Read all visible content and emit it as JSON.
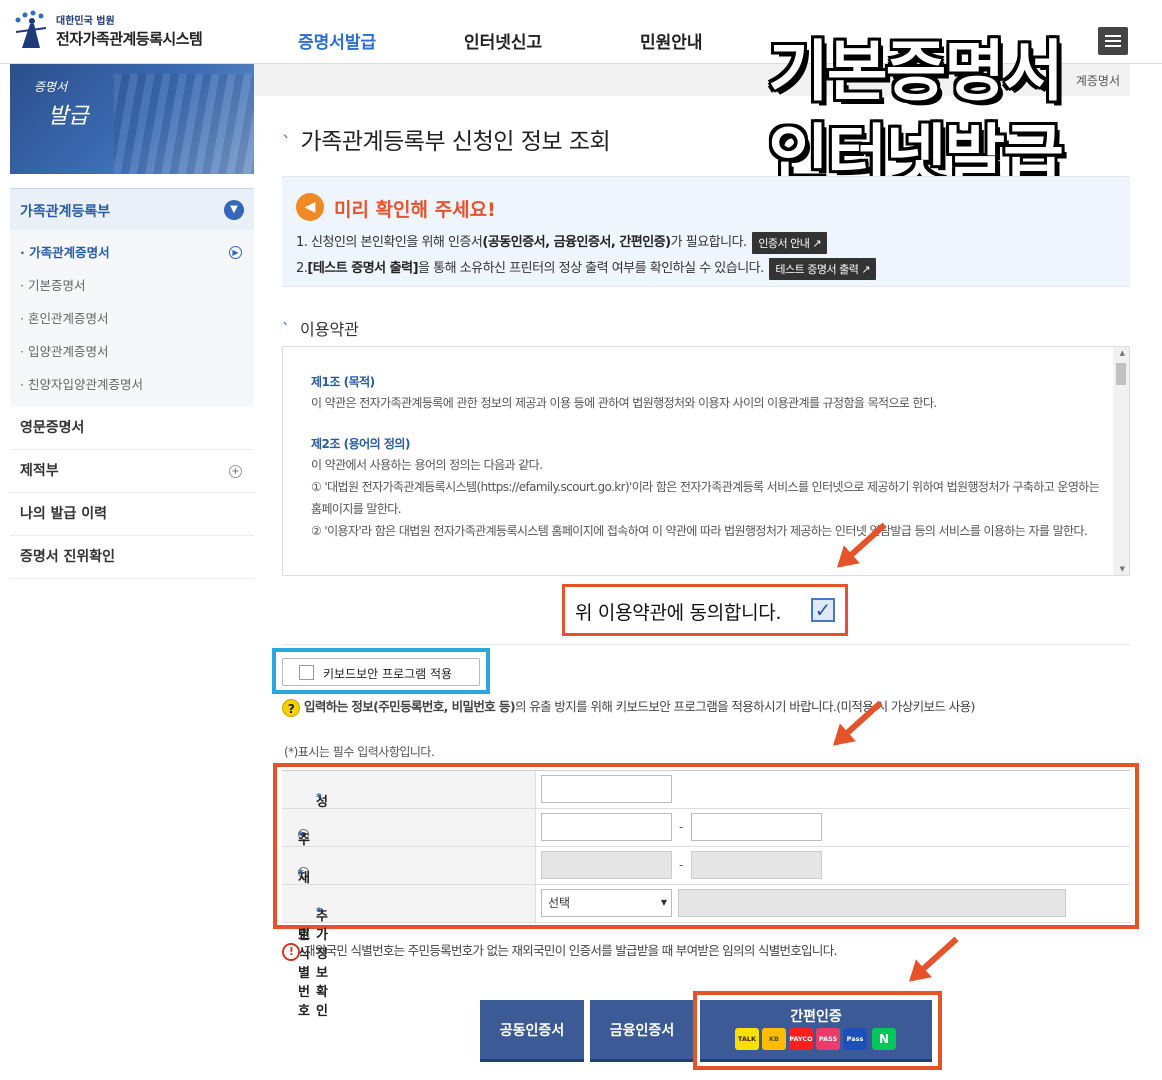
{
  "header": {
    "logo_small": "대한민국 법원",
    "logo_title": "전자가족관계등록시스템",
    "nav": [
      "증명서발급",
      "인터넷신고",
      "민원안내"
    ]
  },
  "overlay": {
    "line1": "기본증명서",
    "line2": "인터넷발급"
  },
  "breadcrumb": "계증명서",
  "sidebar": {
    "banner_line1": "증명서",
    "banner_line2": "발급",
    "group_title": "가족관계등록부",
    "sub_items": [
      "· 가족관계증명서",
      "· 기본증명서",
      "· 혼인관계증명서",
      "· 입양관계증명서",
      "· 친양자입양관계증명서"
    ],
    "main_items": [
      "영문증명서",
      "제적부",
      "나의 발급 이력",
      "증명서 진위확인"
    ]
  },
  "page_title": "가족관계등록부 신청인 정보 조회",
  "notice": {
    "heading": "미리 확인해 주세요!",
    "line1_a": "1. 신청인의 본인확인을 위해 인증서",
    "line1_b": "(공동인증서, 금융인증서, 간편인증)",
    "line1_c": "가 필요합니다.",
    "line1_btn": "인증서 안내 ↗",
    "line2_a": "2.",
    "line2_b": "[테스트 증명서 출력]",
    "line2_c": "을 통해 소유하신 프린터의 정상 출력 여부를 확인하실 수 있습니다.",
    "line2_btn": "테스트 증명서 출력 ↗"
  },
  "terms": {
    "heading": "이용약관",
    "art1_title": "제1조 (목적)",
    "art1_body": "이 약관은 전자가족관계등록에 관한 정보의 제공과 이용 등에 관하여 법원행정처와 이용자 사이의 이용관계를 규정함을 목적으로 한다.",
    "art2_title": "제2조 (용어의 정의)",
    "art2_intro": "이 약관에서 사용하는 용어의 정의는 다음과 같다.",
    "art2_item1": "① '대법원 전자가족관계등록시스템(https://efamily.scourt.go.kr)'이라 함은 전자가족관계등록 서비스를 인터넷으로 제공하기 위하여 법원행정처가 구축하고 운영하는 홈페이지를 말한다.",
    "art2_item2": "② '이용자'라 함은 대법원 전자가족관계등록시스템 홈페이지에 접속하여 이 약관에 따라 법원행정처가 제공하는 인터넷 열람발급 등의 서비스를 이용하는 자를 말한다.",
    "agree_label": "위 이용약관에 동의합니다.",
    "agree_checked": true
  },
  "keyboard": {
    "button_label": "키보드보안 프로그램 적용",
    "note_bold": "입력하는 정보(주민등록번호, 비밀번호 등)",
    "note_rest": "의 유출 방지를 위해 키보드보안 프로그램을 적용하시기 바랍니다.(미적용 시 가상키보드 사용)"
  },
  "required_note": "(*)표시는 필수 입력사항입니다.",
  "form": {
    "name_label": "성명",
    "rrn_label": "주민등록번호",
    "foreign_label": "재외국민 식별번호",
    "extra_label": "추가정보확인",
    "star": "*",
    "dash": "-",
    "select_value": "선택",
    "select_arrow": "▼"
  },
  "id_note": "재외국민 식별번호는 주민등록번호가 없는 재외국민이 인증서를 발급받을 때 부여받은 임의의 식별번호입니다.",
  "auth": {
    "joint_cert": "공동인증서",
    "financial_cert": "금융인증서",
    "easy_auth": "간편인증",
    "providers": [
      "TALK",
      "KB",
      "PAYCO",
      "PASS",
      "Pass",
      "N"
    ]
  },
  "colors": {
    "accent": "#2c6fd1",
    "highlight_red": "#e5532b",
    "highlight_blue": "#2aa7de",
    "button_navy": "#3c5b96"
  }
}
